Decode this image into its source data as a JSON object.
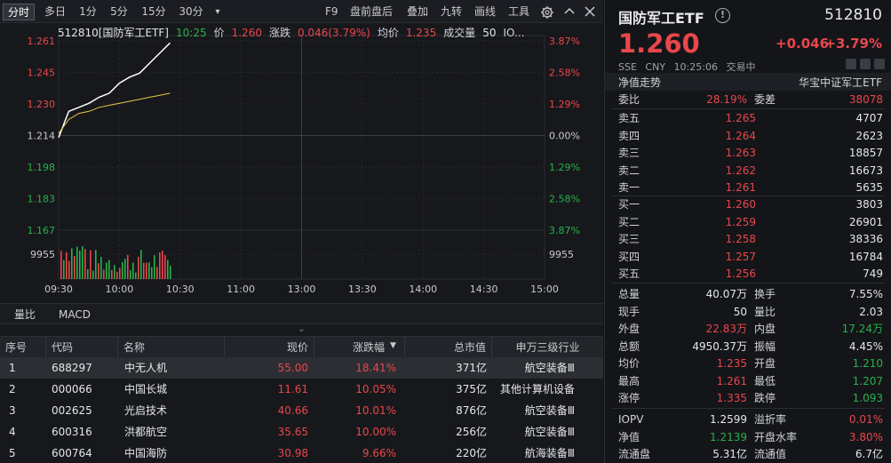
{
  "toolbar": {
    "periods": [
      "分时",
      "多日",
      "1分",
      "5分",
      "15分",
      "30分"
    ],
    "more_arrow": "▾",
    "tools": [
      "F9",
      "盘前盘后",
      "叠加",
      "九转",
      "画线",
      "工具"
    ]
  },
  "chart": {
    "info": {
      "code_name": "512810[国防军工ETF]",
      "time": "10:25",
      "price_label": "价",
      "price": "1.260",
      "change_label": "涨跌",
      "change": "0.046(3.79%)",
      "avg_label": "均价",
      "avg": "1.235",
      "vol_label": "成交量",
      "vol": "50",
      "io": "IO..."
    },
    "left_axis": [
      "1.261",
      "1.245",
      "1.230",
      "1.214",
      "1.198",
      "1.183",
      "1.167",
      "9955"
    ],
    "right_axis": [
      "3.87%",
      "2.58%",
      "1.29%",
      "0.00%",
      "1.29%",
      "2.58%",
      "3.87%",
      "9955"
    ],
    "time_axis": [
      "09:30",
      "10:00",
      "10:30",
      "11:00",
      "13:00",
      "13:30",
      "14:00",
      "14:30",
      "15:00"
    ]
  },
  "chart_data": {
    "type": "line",
    "title": "512810[国防军工ETF]",
    "xlabel": "",
    "ylabel": "",
    "x": [
      "09:30",
      "09:35",
      "09:40",
      "09:45",
      "09:50",
      "09:55",
      "10:00",
      "10:05",
      "10:10",
      "10:15",
      "10:20",
      "10:25"
    ],
    "series": [
      {
        "name": "价",
        "values": [
          1.213,
          1.226,
          1.228,
          1.23,
          1.233,
          1.235,
          1.24,
          1.243,
          1.245,
          1.25,
          1.255,
          1.26
        ]
      },
      {
        "name": "均价",
        "values": [
          1.215,
          1.222,
          1.225,
          1.226,
          1.228,
          1.229,
          1.23,
          1.231,
          1.232,
          1.233,
          1.234,
          1.235
        ]
      }
    ],
    "ylim": [
      1.167,
      1.261
    ],
    "volume_ticks": [
      "9955"
    ],
    "grid": true
  },
  "indicator_tabs": [
    "量比",
    "MACD"
  ],
  "collapse_icon": "double-chevron-down-icon",
  "collapse_glyph": "⌄",
  "list": {
    "headers": [
      "序号",
      "代码",
      "名称",
      "现价",
      "涨跌幅",
      "总市值",
      "申万三级行业"
    ],
    "sort_arrow": "▼",
    "rows": [
      {
        "no": "1",
        "code": "688297",
        "name": "中无人机",
        "price": "55.00",
        "pct": "18.41%",
        "cap": "371亿",
        "ind": "航空装备Ⅲ"
      },
      {
        "no": "2",
        "code": "000066",
        "name": "中国长城",
        "price": "11.61",
        "pct": "10.05%",
        "cap": "375亿",
        "ind": "其他计算机设备"
      },
      {
        "no": "3",
        "code": "002625",
        "name": "光启技术",
        "price": "40.66",
        "pct": "10.01%",
        "cap": "876亿",
        "ind": "航空装备Ⅲ"
      },
      {
        "no": "4",
        "code": "600316",
        "name": "洪都航空",
        "price": "35.65",
        "pct": "10.00%",
        "cap": "256亿",
        "ind": "航空装备Ⅲ"
      },
      {
        "no": "5",
        "code": "600764",
        "name": "中国海防",
        "price": "30.98",
        "pct": "9.66%",
        "cap": "220亿",
        "ind": "航海装备Ⅲ"
      }
    ]
  },
  "quote": {
    "name": "国防军工ETF",
    "info_icon": "info-circle-icon",
    "info_glyph": "!",
    "code": "512810",
    "price": "1.260",
    "change": "+0.046",
    "change_pct": "+3.79%",
    "market": "SSE",
    "currency": "CNY",
    "time": "10:25:06",
    "status": "交易中",
    "net_trend": "净值走势",
    "index_name": "华宝中证军工ETF",
    "wei": {
      "label_a": "委比",
      "val_a": "28.19%",
      "label_b": "委差",
      "val_b": "38078"
    },
    "asks": [
      {
        "label": "卖五",
        "price": "1.265",
        "vol": "4707"
      },
      {
        "label": "卖四",
        "price": "1.264",
        "vol": "2623"
      },
      {
        "label": "卖三",
        "price": "1.263",
        "vol": "18857"
      },
      {
        "label": "卖二",
        "price": "1.262",
        "vol": "16673"
      },
      {
        "label": "卖一",
        "price": "1.261",
        "vol": "5635"
      }
    ],
    "bids": [
      {
        "label": "买一",
        "price": "1.260",
        "vol": "3803"
      },
      {
        "label": "买二",
        "price": "1.259",
        "vol": "26901"
      },
      {
        "label": "买三",
        "price": "1.258",
        "vol": "38336"
      },
      {
        "label": "买四",
        "price": "1.257",
        "vol": "16784"
      },
      {
        "label": "买五",
        "price": "1.256",
        "vol": "749"
      }
    ],
    "stats": [
      {
        "l1": "总量",
        "v1": "40.07万",
        "l2": "换手",
        "v2": "7.55%"
      },
      {
        "l1": "现手",
        "v1": "50",
        "l2": "量比",
        "v2": "2.03"
      },
      {
        "l1": "外盘",
        "v1": "22.83万",
        "l2": "内盘",
        "v2": "17.24万"
      },
      {
        "l1": "总额",
        "v1": "4950.37万",
        "l2": "振幅",
        "v2": "4.45%"
      },
      {
        "l1": "均价",
        "v1": "1.235",
        "l2": "开盘",
        "v2": "1.210"
      },
      {
        "l1": "最高",
        "v1": "1.261",
        "l2": "最低",
        "v2": "1.207"
      },
      {
        "l1": "涨停",
        "v1": "1.335",
        "l2": "跌停",
        "v2": "1.093"
      }
    ],
    "stats2": [
      {
        "l1": "IOPV",
        "v1": "1.2599",
        "l2": "溢折率",
        "v2": "0.01%"
      },
      {
        "l1": "净值",
        "v1": "1.2139",
        "l2": "开盘水率",
        "v2": "3.80%"
      },
      {
        "l1": "流通盘",
        "v1": "5.31亿",
        "l2": "流通值",
        "v2": "6.7亿"
      }
    ]
  },
  "colors": {
    "up": "#e8474b",
    "down": "#28b24a",
    "price_line": "#ffffff",
    "avg_line": "#e6c84a",
    "bg": "#16171b"
  }
}
